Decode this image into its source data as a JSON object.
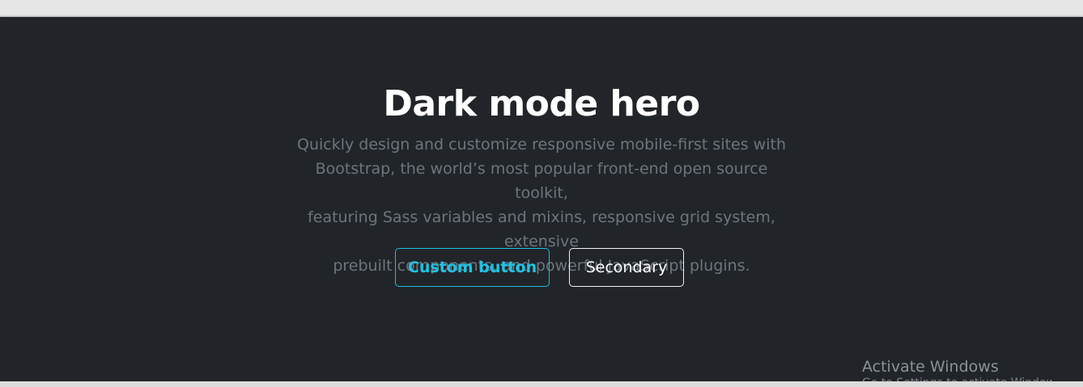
{
  "hero": {
    "title": "Dark mode hero",
    "lead_lines": [
      "Quickly design and customize responsive mobile-first sites with",
      "Bootstrap, the world’s most popular front-end open source toolkit,",
      "featuring Sass variables and mixins, responsive grid system, extensive",
      "prebuilt components, and powerful JavaScript plugins."
    ],
    "buttons": {
      "custom_label": "Custom button",
      "secondary_label": "Secondary"
    }
  },
  "watermark": {
    "title": "Activate Windows",
    "subtitle": "Go to Settings to activate Windows."
  },
  "colors": {
    "background": "#212529",
    "title": "#ffffff",
    "lead": "#6c757d",
    "accent": "#20c3e3",
    "secondary_border": "#f2f2f2"
  }
}
